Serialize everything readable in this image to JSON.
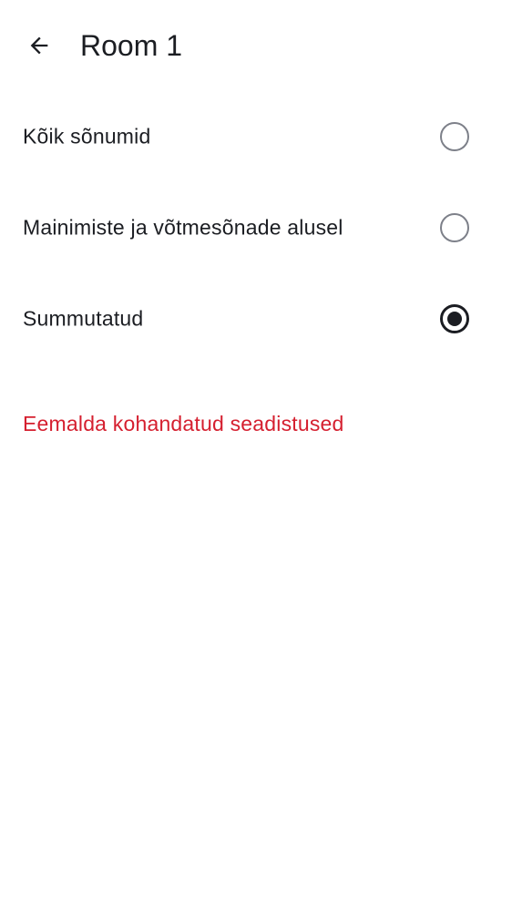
{
  "header": {
    "back_icon": "arrow-left-icon",
    "title": "Room 1"
  },
  "options": [
    {
      "label": "Kõik sõnumid",
      "selected": false
    },
    {
      "label": "Mainimiste ja võtmesõnade alusel",
      "selected": false
    },
    {
      "label": "Summutatud",
      "selected": true
    }
  ],
  "remove_custom_settings": "Eemalda kohandatud seadistused",
  "colors": {
    "text": "#1b1d22",
    "radio_unselected": "#7d8089",
    "destructive": "#d51f2f",
    "background": "#ffffff"
  }
}
